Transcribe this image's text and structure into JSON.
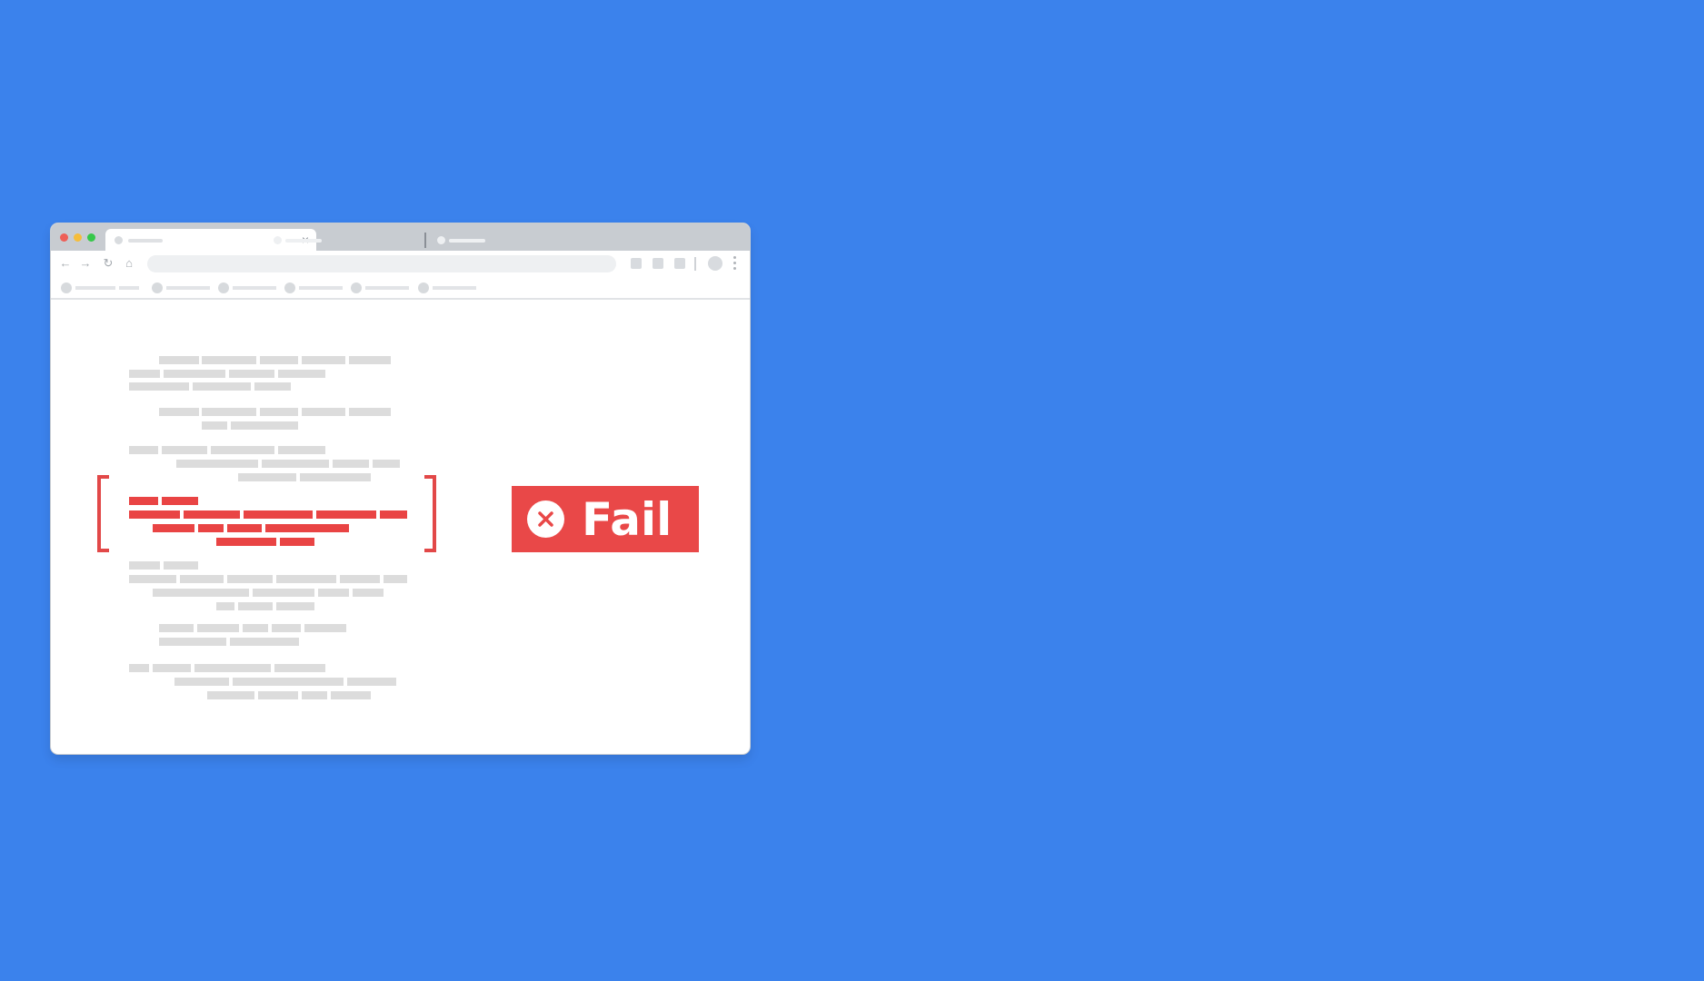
{
  "colors": {
    "background": "#3b82ec",
    "fail": "#e94848",
    "text_placeholder": "#dcdcdc",
    "highlighted_text": "#e94444"
  },
  "browser": {
    "traffic_lights": [
      {
        "name": "close",
        "color": "#ee5f57"
      },
      {
        "name": "minimize",
        "color": "#f6bd3a"
      },
      {
        "name": "maximize",
        "color": "#36c84a"
      }
    ],
    "tabs": [
      {
        "state": "active",
        "has_close": true
      },
      {
        "state": "inactive",
        "has_close": false
      },
      {
        "state": "inactive",
        "has_close": false
      }
    ],
    "tab_close_glyph": "×",
    "nav_icons": {
      "back": "←",
      "forward": "→",
      "reload": "↻",
      "home": "⌂"
    },
    "bookmark_count": 6
  },
  "result_badge": {
    "label": "Fail",
    "icon": "x-circle-icon",
    "status": "fail"
  }
}
